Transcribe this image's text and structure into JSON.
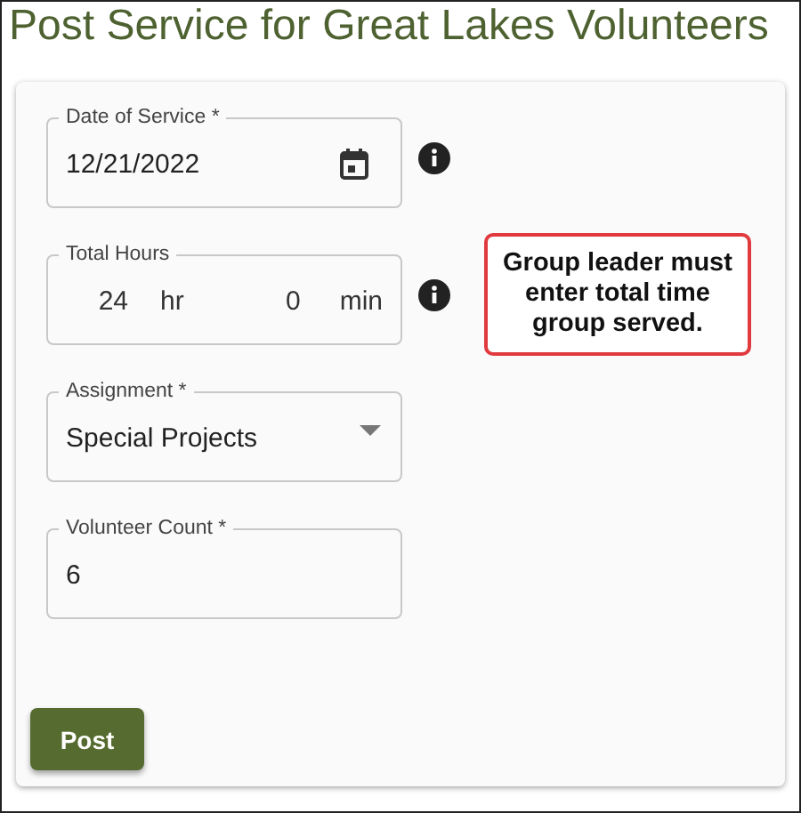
{
  "title": "Post Service for Great Lakes Volunteers",
  "fields": [
    {
      "kind": "date",
      "label": "Date of Service  *",
      "value": "12/21/2022",
      "info": true
    },
    {
      "kind": "duration",
      "label": "Total Hours",
      "hours": "24",
      "hours_unit": "hr",
      "minutes": "0",
      "minutes_unit": "min",
      "info": true,
      "note": "Group leader must enter total time group served."
    },
    {
      "kind": "select",
      "label": "Assignment  *",
      "value": "Special Projects",
      "info": false
    },
    {
      "kind": "number",
      "label": "Volunteer Count  *",
      "value": "6",
      "info": false
    }
  ],
  "submit": "Post"
}
